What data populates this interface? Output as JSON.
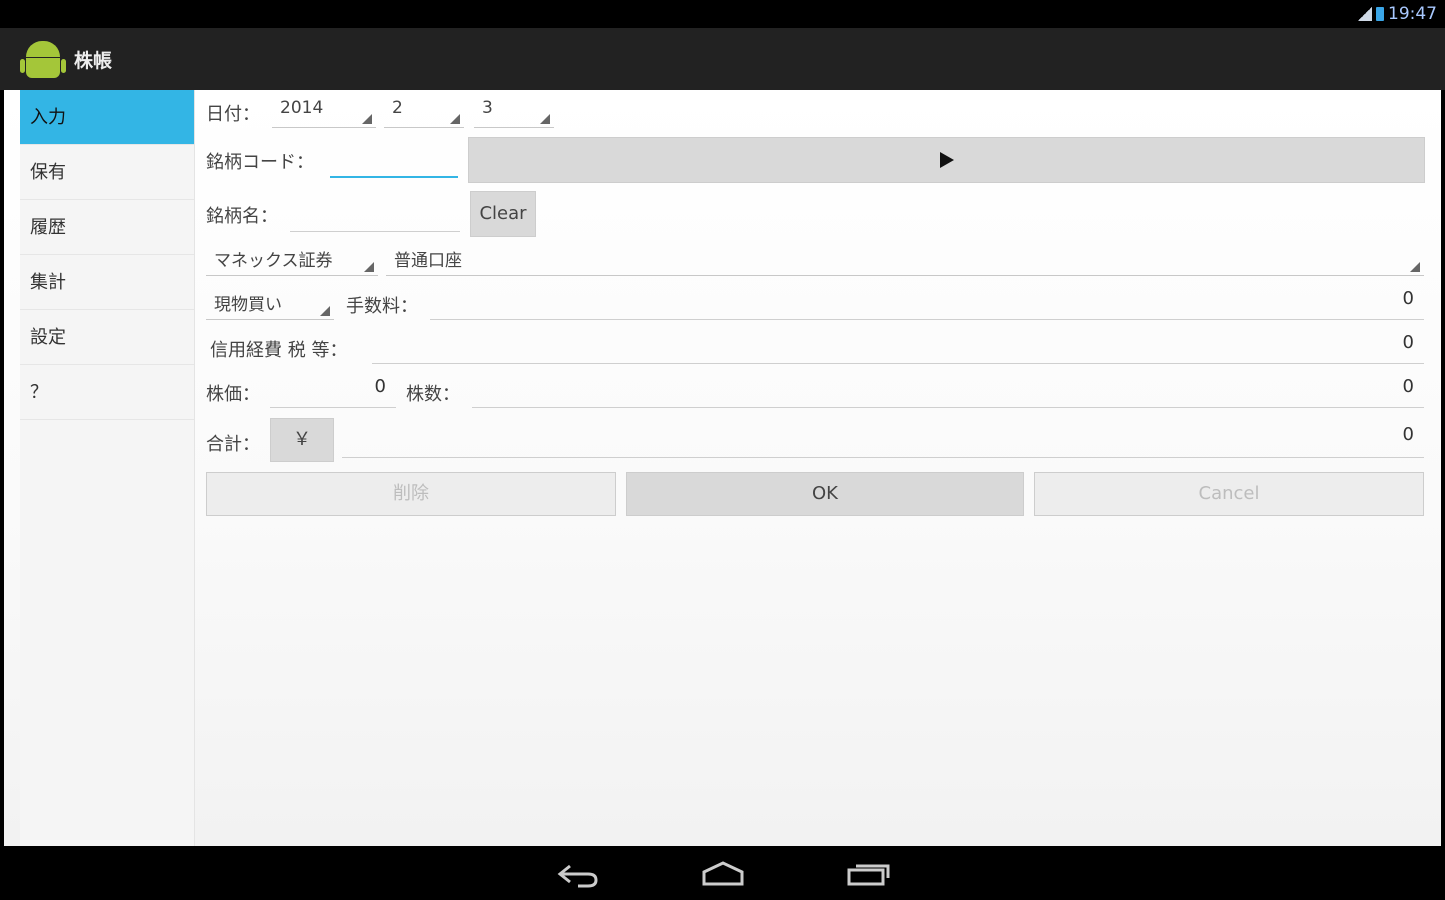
{
  "status_bar": {
    "time": "19:47"
  },
  "action_bar": {
    "title": "株帳",
    "icon": "android-icon"
  },
  "sidebar": {
    "items": [
      {
        "label": "入力",
        "active": true
      },
      {
        "label": "保有"
      },
      {
        "label": "履歴"
      },
      {
        "label": "集計"
      },
      {
        "label": "設定"
      },
      {
        "label": "？"
      }
    ]
  },
  "form": {
    "date_label": "日付：",
    "year": "2014",
    "month": "2",
    "day": "3",
    "code_label": "銘柄コード：",
    "code_value": "",
    "name_label": "銘柄名：",
    "name_value": "",
    "clear_button": "Clear",
    "broker": "マネックス証券",
    "account": "普通口座",
    "trade_type": "現物買い",
    "fee_label": "手数料：",
    "fee_value": "0",
    "margin_label": "信用経費 税 等：",
    "margin_value": "0",
    "price_label": "株価：",
    "price_value": "0",
    "shares_label": "株数：",
    "shares_value": "0",
    "total_label": "合計：",
    "yen_button": "￥",
    "total_value": "0",
    "delete_button": "削除",
    "ok_button": "OK",
    "cancel_button": "Cancel"
  },
  "colors": {
    "accent": "#33b5e5",
    "android_green": "#a4c639"
  }
}
